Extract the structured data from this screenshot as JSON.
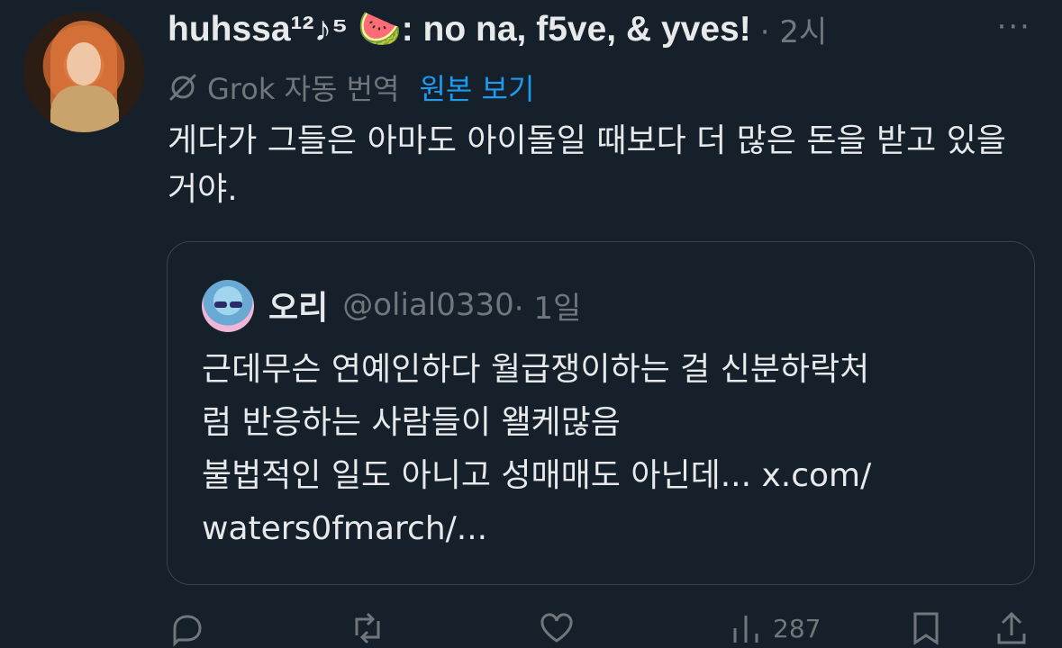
{
  "post": {
    "display_name": "huhssa¹²♪⁵ 🍉: no na, f5ve, & yves!",
    "time": "· 2시",
    "more_label": "···",
    "translation_label": "Grok 자동 번역",
    "show_original": "원본 보기",
    "text": "게다가 그들은 아마도 아이돌일 때보다 더 많은 돈을 받고 있을 거야."
  },
  "quote": {
    "display_name": "오리",
    "handle": "@olial0330",
    "time": " · 1일",
    "text_lines": [
      "근데무슨 연예인하다 월급쟁이하는 걸 신분하락처",
      "럼 반응하는 사람들이 왤케많음",
      "불법적인 일도 아니고 성매매도 아닌데... x.com/",
      "waters0fmarch/..."
    ]
  },
  "actions": {
    "views_count": "287"
  },
  "icons": {
    "grok": "grok-slash-icon",
    "reply": "reply-icon",
    "repost": "repost-icon",
    "like": "like-icon",
    "views": "views-icon",
    "bookmark": "bookmark-icon",
    "share": "share-icon"
  },
  "colors": {
    "background": "#15202b",
    "text": "#e7e9ea",
    "secondary": "#71767b",
    "link": "#1d9bf0",
    "border": "#38444d"
  }
}
